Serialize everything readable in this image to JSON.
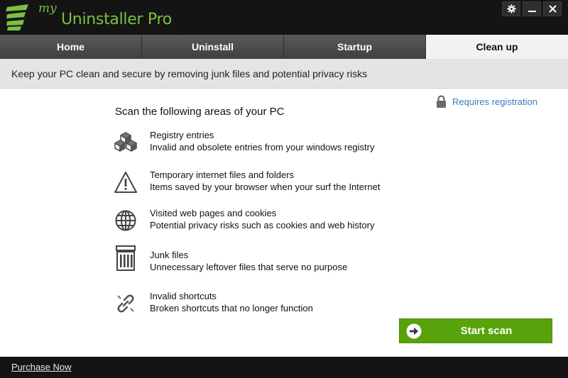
{
  "window": {
    "logo_prefix": "my",
    "logo_name": "Uninstaller Pro",
    "buttons": [
      "gear-icon",
      "minimize-icon",
      "close-icon"
    ]
  },
  "tabs": [
    {
      "label": "Home",
      "active": false
    },
    {
      "label": "Uninstall",
      "active": false
    },
    {
      "label": "Startup",
      "active": false
    },
    {
      "label": "Clean up",
      "active": true
    }
  ],
  "subtitle": "Keep your PC clean and secure by removing junk files and potential privacy risks",
  "registration": {
    "label": "Requires registration",
    "icon": "lock-icon"
  },
  "scan": {
    "heading": "Scan the following areas of your PC",
    "areas": [
      {
        "icon": "registry-icon",
        "title": "Registry entries",
        "desc": "Invalid and obsolete entries from your windows registry"
      },
      {
        "icon": "warning-icon",
        "title": "Temporary internet files and folders",
        "desc": "Items saved by your browser when your surf the Internet"
      },
      {
        "icon": "globe-icon",
        "title": "Visited web pages and cookies",
        "desc": "Potential privacy risks such as cookies and web history"
      },
      {
        "icon": "trash-icon",
        "title": "Junk files",
        "desc": "Unnecessary leftover files that serve no purpose"
      },
      {
        "icon": "broken-link-icon",
        "title": "Invalid shortcuts",
        "desc": "Broken shortcuts that no longer function"
      }
    ],
    "start_label": "Start scan"
  },
  "footer": {
    "purchase_label": "Purchase Now"
  },
  "colors": {
    "accent_green": "#58a30c",
    "logo_green": "#7ac142",
    "link_blue": "#3a7bbf",
    "titlebar": "#141414"
  }
}
